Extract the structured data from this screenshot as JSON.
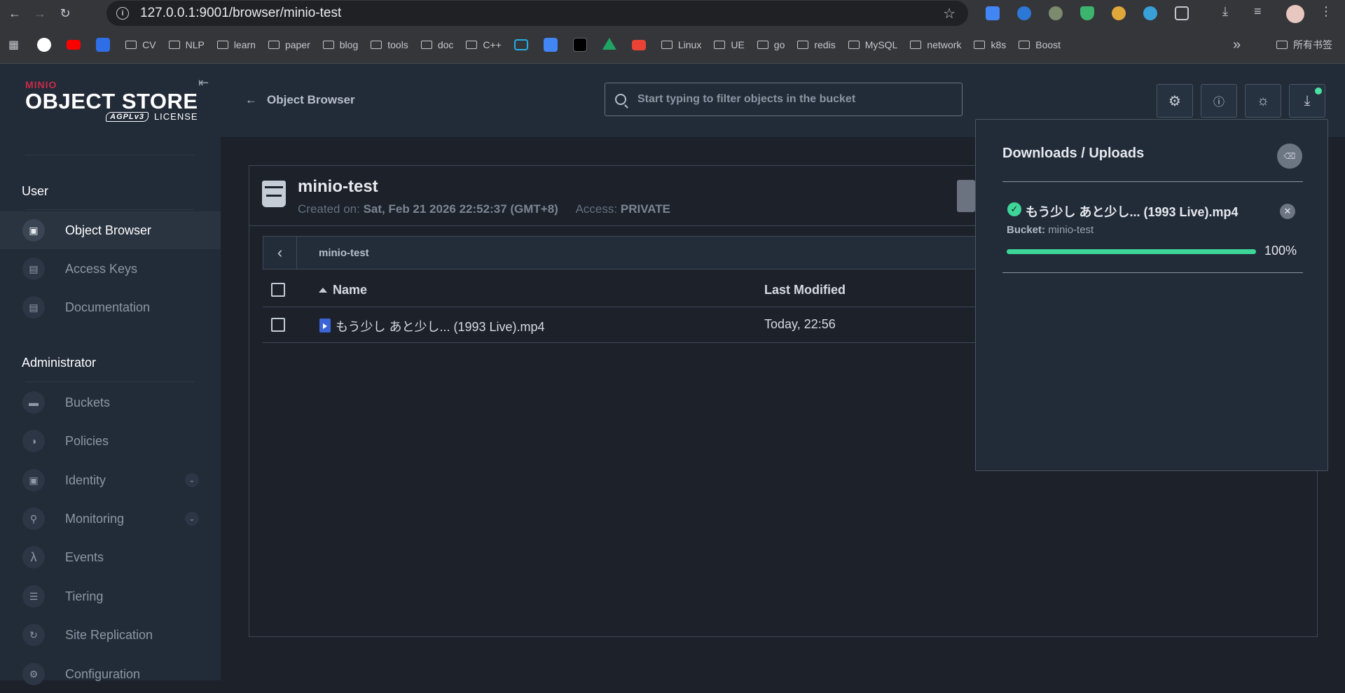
{
  "browser": {
    "url": "127.0.0.1:9001/browser/minio-test",
    "bookmarks": [
      "CV",
      "NLP",
      "learn",
      "paper",
      "blog",
      "tools",
      "doc",
      "C++",
      "Linux",
      "UE",
      "go",
      "redis",
      "MySQL",
      "network",
      "k8s",
      "Boost"
    ],
    "more": "»",
    "all_bookmarks": "所有书签"
  },
  "logo": {
    "brand": "MINIO",
    "product": "OBJECT STORE",
    "license_badge": "AGPLv3",
    "license": "LICENSE"
  },
  "sidebar": {
    "user_section": "User",
    "user_items": [
      {
        "label": "Object Browser",
        "icon": "object-browser-icon"
      },
      {
        "label": "Access Keys",
        "icon": "access-keys-icon"
      },
      {
        "label": "Documentation",
        "icon": "documentation-icon"
      }
    ],
    "admin_section": "Administrator",
    "admin_items": [
      {
        "label": "Buckets",
        "icon": "buckets-icon"
      },
      {
        "label": "Policies",
        "icon": "policies-icon"
      },
      {
        "label": "Identity",
        "icon": "identity-icon"
      },
      {
        "label": "Monitoring",
        "icon": "monitoring-icon"
      },
      {
        "label": "Events",
        "icon": "lambda-icon"
      },
      {
        "label": "Tiering",
        "icon": "tiering-icon"
      },
      {
        "label": "Site Replication",
        "icon": "replication-icon"
      },
      {
        "label": "Configuration",
        "icon": "gear-icon"
      }
    ]
  },
  "header": {
    "back_label": "Object Browser",
    "search_placeholder": "Start typing to filter objects in the bucket"
  },
  "bucket": {
    "name": "minio-test",
    "created_label": "Created on:",
    "created_value": "Sat, Feb 21 2026 22:52:37 (GMT+8)",
    "access_label": "Access:",
    "access_value": "PRIVATE",
    "breadcrumb": "minio-test"
  },
  "table": {
    "col_name": "Name",
    "col_modified": "Last Modified",
    "rows": [
      {
        "name": "もう少し あと少し... (1993 Live).mp4",
        "modified": "Today, 22:56"
      }
    ]
  },
  "transfers": {
    "title": "Downloads / Uploads",
    "items": [
      {
        "file": "もう少し あと少し... (1993 Live).mp4",
        "bucket_label": "Bucket:",
        "bucket": "minio-test",
        "progress_text": "100%",
        "progress": 1.0
      }
    ]
  },
  "colors": {
    "accent": "#3dd598",
    "brand": "#c72c48",
    "background": "#1c212a",
    "sidebar": "#222b38"
  }
}
